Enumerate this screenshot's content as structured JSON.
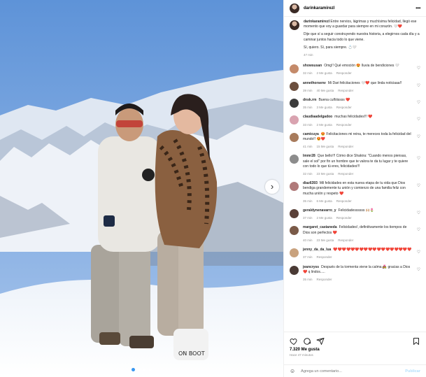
{
  "post": {
    "username": "darinkaramirezl",
    "caption_lines": [
      "Entre nervios, lágrimas y muchísima felicidad, llegó ese momento que voy a guardar para siempre en mi corazón. 🤍❤️",
      "Dije que sí a seguir construyendo nuestra historia, a elegirnos cada día y a caminar juntos hacia todo lo que viene.",
      "Sí, quiero. Sí, para siempre. 💍🤍"
    ],
    "caption_time": "47 min"
  },
  "comments": [
    {
      "user": "showsusan",
      "text": "Omg!! Qué emoción 😍 lluvia de bendiciones 🤍",
      "time": "32 min",
      "likes": "2 Me gusta",
      "reply": "Responder",
      "color": "#c48a6a"
    },
    {
      "user": "annethorsenv",
      "text": "Mi Dari felicitaciones 🤍❤️ que linda noticiaaa!!",
      "time": "39 min",
      "likes": "40 Me gusta",
      "reply": "Responder",
      "color": "#6b4e3d"
    },
    {
      "user": "dnsk.rm",
      "text": "Buena cuñiiissss ❤️",
      "time": "35 min",
      "likes": "3 Me gusta",
      "reply": "Responder",
      "color": "#3c3c3c"
    },
    {
      "user": "claudiaadelgadoo",
      "text": "muchas felicidades!!! ❤️",
      "time": "33 min",
      "likes": "2 Me gusta",
      "reply": "Responder",
      "color": "#d9a3b0"
    },
    {
      "user": "camicuya",
      "text": "😍 Felicitaciones mi reina, te mereces toda la felicidad del mundo!! 😍❤️",
      "time": "41 min",
      "likes": "15 Me gusta",
      "reply": "Responder",
      "color": "#a87b5c"
    },
    {
      "user": "lmmr28",
      "text": "Que bello!!! Cómo dice Shakira: \"Cuando menos piensas, sale el sol\" por fin un hombre que te valora te da tu lugar y te quiere con todo lo que tú eres, felicidades!!!",
      "time": "32 min",
      "likes": "23 Me gusta",
      "reply": "Responder",
      "color": "#8c8c8c"
    },
    {
      "user": "diaz6393",
      "text": "Mil felicidades en esta nueva etapa de tu vida que Dios bendiga grandemente tu unión y comienzo de una familia feliz con mucha unión y respeto ❤️",
      "time": "35 min",
      "likes": "6 Me gusta",
      "reply": "Responder",
      "color": "#b07a7a"
    },
    {
      "user": "geraldynenavarro_y",
      "text": "Felicidadessssss 🙌🏼🌷",
      "time": "37 min",
      "likes": "2 Me gusta",
      "reply": "Responder",
      "color": "#5a4038"
    },
    {
      "user": "margaret_castaneda",
      "text": "Felicidades!, definitivamente los tiempos de Dios son perfectos ❤️",
      "time": "40 min",
      "likes": "23 Me gusta",
      "reply": "Responder",
      "color": "#7a5a48"
    },
    {
      "user": "jenny_da_da_lua",
      "text": "❤️❤️❤️❤️❤️❤️❤️❤️❤️❤️❤️❤️❤️❤️❤️❤️❤️❤️",
      "time": "37 min",
      "likes": "",
      "reply": "Responder",
      "color": "#c9a27e"
    },
    {
      "user": "jeancryss",
      "text": "Después de la tormenta viene la calma 👩‍❤️‍👨 gracias a Dios ❤️ q lindos.....",
      "time": "35 min",
      "likes": "",
      "reply": "Responder",
      "color": "#4a3a35"
    }
  ],
  "actions": {
    "likes_count": "7.320 Me gusta",
    "time_ago": "Hace 47 minutos",
    "comment_placeholder": "Agrega un comentario...",
    "publish_label": "Publicar",
    "emoji_icon": "emoji-icon"
  },
  "colors": {
    "accent": "#0095f6",
    "heart_red": "#ed4956",
    "secondary_text": "#8e8e8e"
  }
}
